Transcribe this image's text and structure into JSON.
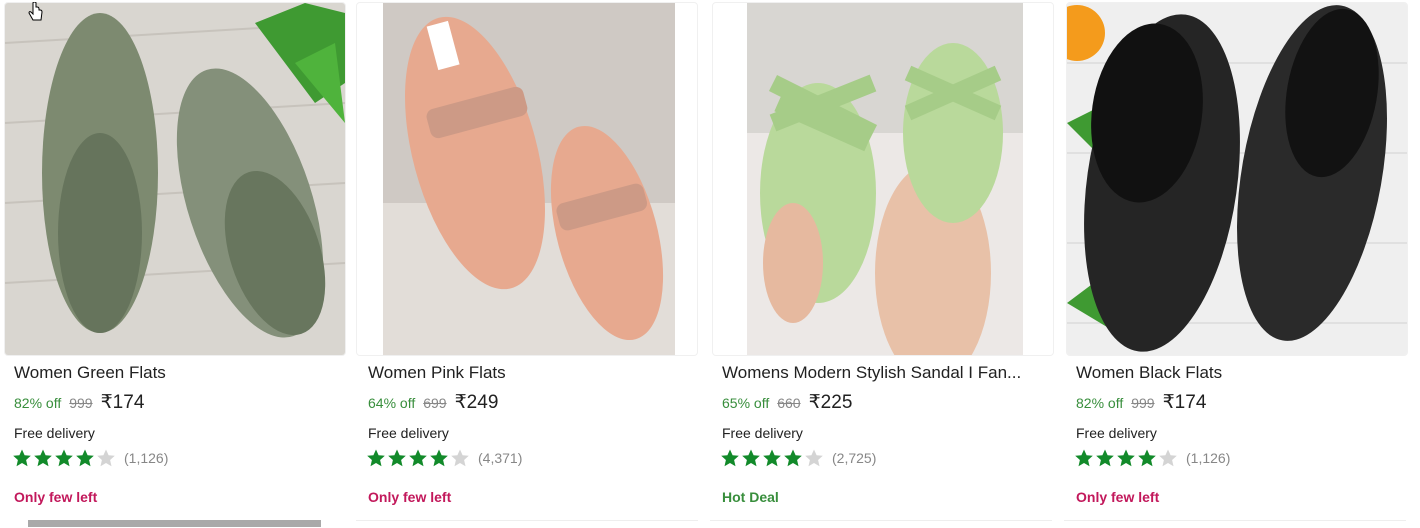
{
  "products": [
    {
      "title": "Women Green Flats",
      "discount": "82% off",
      "mrp": "999",
      "price": "₹174",
      "delivery": "Free delivery",
      "rating_count": "(1,126)",
      "rating_stars": 4,
      "tag": "Only few left",
      "tag_color": "#c2185b",
      "image_icon": "green-flats-image"
    },
    {
      "title": "Women Pink Flats",
      "discount": "64% off",
      "mrp": "699",
      "price": "₹249",
      "delivery": "Free delivery",
      "rating_count": "(4,371)",
      "rating_stars": 4,
      "tag": "Only few left",
      "tag_color": "#c2185b",
      "image_icon": "pink-flats-image"
    },
    {
      "title": "Womens Modern Stylish Sandal I Fan...",
      "discount": "65% off",
      "mrp": "660",
      "price": "₹225",
      "delivery": "Free delivery",
      "rating_count": "(2,725)",
      "rating_stars": 4,
      "tag": "Hot Deal",
      "tag_color": "#388e3c",
      "image_icon": "green-sandal-image"
    },
    {
      "title": "Women Black Flats",
      "discount": "82% off",
      "mrp": "999",
      "price": "₹174",
      "delivery": "Free delivery",
      "rating_count": "(1,126)",
      "rating_stars": 4,
      "tag": "Only few left",
      "tag_color": "#c2185b",
      "image_icon": "black-flats-image"
    }
  ],
  "colors": {
    "discount": "#388e3c",
    "star_filled": "#14958f",
    "star_empty": "#d4d4d4",
    "strike": "#878787"
  }
}
